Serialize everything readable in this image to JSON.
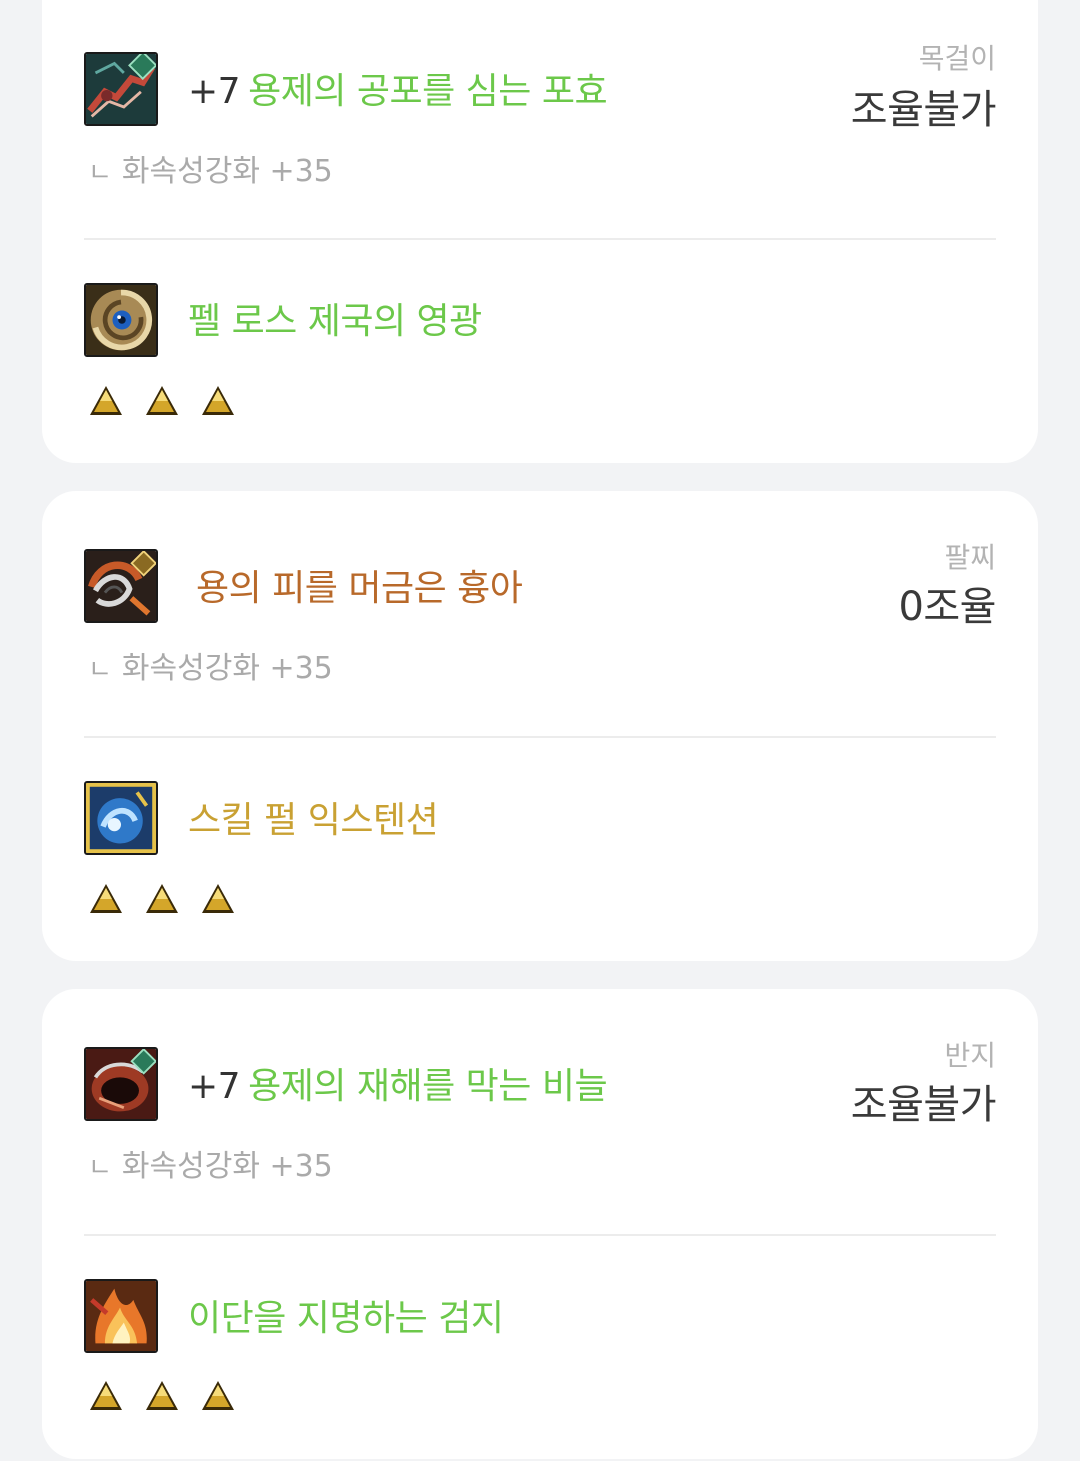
{
  "cards": [
    {
      "slot_label": "목걸이",
      "slot_status": "조율불가",
      "equip": {
        "reinforce": "+7",
        "name": "용제의 공포를 심는 포효",
        "name_color": "#6cc84a",
        "sub": "화속성강화 +35",
        "sub_mark": "ㄴ",
        "icon": "dragon-necklace-icon"
      },
      "creature": {
        "name": "펠 로스 제국의 영광",
        "name_color": "#6cc84a",
        "icon": "eye-vortex-icon",
        "triangles": 3
      }
    },
    {
      "slot_label": "팔찌",
      "slot_status": "0조율",
      "equip": {
        "reinforce": "",
        "name": "용의 피를 머금은 흉아",
        "name_color": "#b8692a",
        "sub": "화속성강화 +35",
        "sub_mark": "ㄴ",
        "icon": "dragon-bracelet-icon"
      },
      "creature": {
        "name": "스킬 펄 익스텐션",
        "name_color": "#c9a133",
        "icon": "blue-pearl-icon",
        "triangles": 3
      }
    },
    {
      "slot_label": "반지",
      "slot_status": "조율불가",
      "equip": {
        "reinforce": "+7",
        "name": "용제의 재해를 막는 비늘",
        "name_color": "#6cc84a",
        "sub": "화속성강화 +35",
        "sub_mark": "ㄴ",
        "icon": "scale-ring-icon"
      },
      "creature": {
        "name": "이단을 지명하는 검지",
        "name_color": "#6cc84a",
        "icon": "flame-finger-icon",
        "triangles": 3
      }
    }
  ]
}
